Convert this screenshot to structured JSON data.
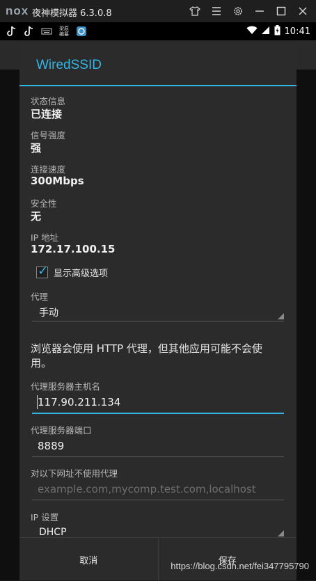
{
  "emulator": {
    "logo": "nox",
    "title": "夜神模拟器 6.3.0.8",
    "controls": [
      "shirt-icon",
      "menu-icon",
      "gear-icon",
      "minimize-icon",
      "maximize-icon",
      "close-icon"
    ]
  },
  "status_bar": {
    "left_icons": [
      "tiktok-icon",
      "tiktok-icon",
      "keyboard-icon",
      "app-icon",
      "store-icon"
    ],
    "app_icon_text": "梁原\n编纂",
    "time": "10:41"
  },
  "dialog": {
    "title": "WiredSSID",
    "info": [
      {
        "label": "状态信息",
        "value": "已连接"
      },
      {
        "label": "信号强度",
        "value": "强"
      },
      {
        "label": "连接速度",
        "value": "300Mbps"
      },
      {
        "label": "安全性",
        "value": "无"
      },
      {
        "label": "IP 地址",
        "value": "172.17.100.15"
      }
    ],
    "advanced": {
      "label": "显示高级选项",
      "checked": true
    },
    "proxy": {
      "label": "代理",
      "value": "手动"
    },
    "note": "浏览器会使用 HTTP 代理，但其他应用可能不会使用。",
    "hostname": {
      "label": "代理服务器主机名",
      "value": "117.90.211.134"
    },
    "port": {
      "label": "代理服务器端口",
      "value": "8889"
    },
    "bypass": {
      "label": "对以下网址不使用代理",
      "placeholder": "example.com,mycomp.test.com,localhost"
    },
    "ip_settings": {
      "label": "IP 设置",
      "value": "DHCP"
    },
    "buttons": {
      "cancel": "取消",
      "save": "保存"
    }
  },
  "watermark": "https://blog.csdn.net/fei347795790",
  "colors": {
    "accent": "#33b5e5",
    "dialog_bg": "#2b2b2b"
  }
}
